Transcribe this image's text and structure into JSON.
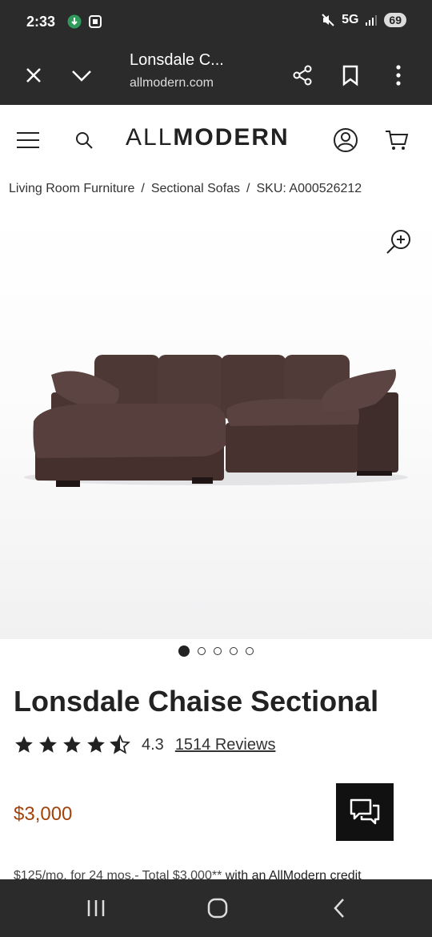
{
  "status_bar": {
    "time": "2:33",
    "network": "5G",
    "battery": "69",
    "icons": [
      "whatsapp-style-icon",
      "screenshot-icon",
      "mute-icon",
      "signal-icon"
    ]
  },
  "browser": {
    "title": "Lonsdale C...",
    "url": "allmodern.com",
    "icons": [
      "close-icon",
      "chevron-down-icon",
      "share-icon",
      "bookmark-icon",
      "more-vert-icon"
    ]
  },
  "header": {
    "logo_light": "ALL",
    "logo_bold": "MODERN",
    "icons": [
      "menu-icon",
      "search-icon",
      "account-icon",
      "cart-icon"
    ]
  },
  "breadcrumb": {
    "items": [
      "Living Room Furniture",
      "Sectional Sofas",
      "SKU: A000526212"
    ],
    "separator": "/"
  },
  "gallery": {
    "image_alt": "Lonsdale Chaise Sectional sofa",
    "slide_count": 5,
    "active_slide": 1,
    "sofa_color": "#4a3533",
    "zoom_icon": "zoom-in-icon"
  },
  "product": {
    "title": "Lonsdale Chaise Sectional",
    "rating": "4.3",
    "rating_fraction": 0.86,
    "reviews": "1514 Reviews",
    "price": "$3,000",
    "price_color": "#a2430c",
    "financing_text": "$125/mo. for 24 mos.- Total $3,000** ",
    "financing_strong": "with an AllModern credit"
  },
  "nav": {
    "icons": [
      "recent-apps-icon",
      "home-icon",
      "back-icon"
    ]
  }
}
